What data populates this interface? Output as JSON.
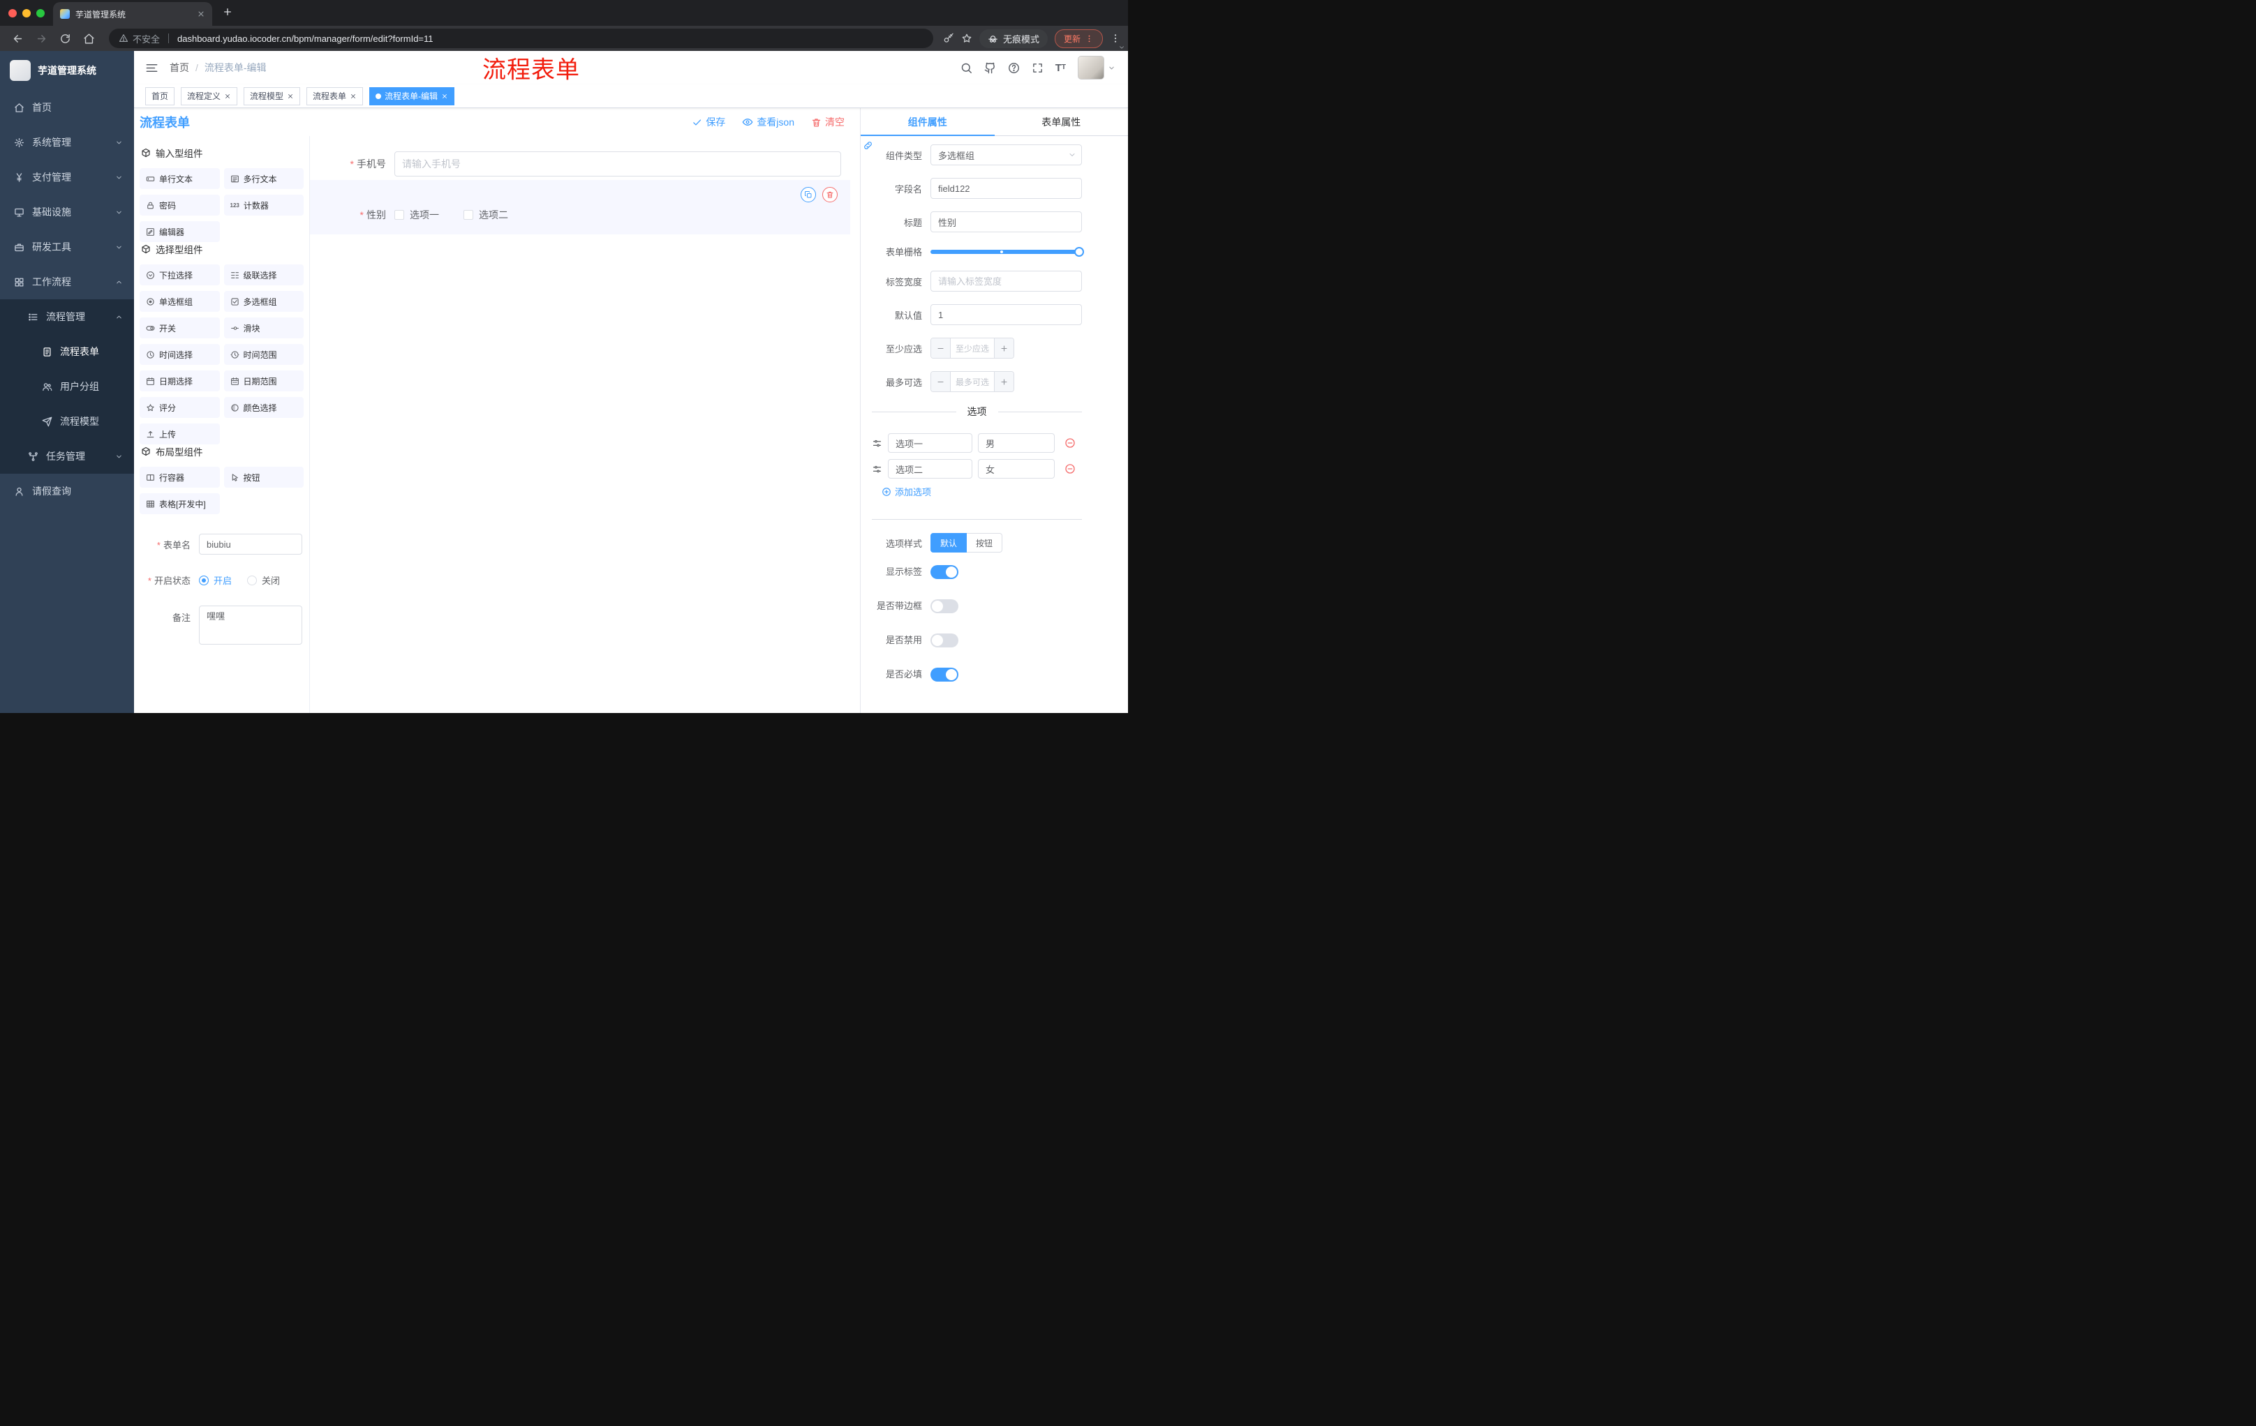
{
  "colors": {
    "accent": "#409eff",
    "danger": "#f56c6c",
    "annotation_red": "#f21d0d",
    "sidebar_bg": "#304156",
    "sidebar_sub_bg": "#1f2d3d",
    "tag_active": "#409eff"
  },
  "browser": {
    "tab": {
      "title": "芋道管理系统"
    },
    "nav_icons": [
      {
        "id": "back",
        "disabled": false
      },
      {
        "id": "forward",
        "disabled": true
      },
      {
        "id": "reload",
        "disabled": false
      },
      {
        "id": "homebtn",
        "disabled": false
      }
    ],
    "address": {
      "security_label": "不安全",
      "url": "dashboard.yudao.iocoder.cn/bpm/manager/form/edit?formId=11"
    },
    "incognito_label": "无痕模式",
    "update_button": "更新"
  },
  "sidebar": {
    "logo_title": "芋道管理系统",
    "items": [
      {
        "id": "home",
        "label": "首页",
        "icon": "home",
        "level": 1
      },
      {
        "id": "system",
        "label": "系统管理",
        "icon": "gear",
        "level": 1,
        "chevron": "down"
      },
      {
        "id": "payment",
        "label": "支付管理",
        "icon": "yen",
        "level": 1,
        "chevron": "down"
      },
      {
        "id": "infra",
        "label": "基础设施",
        "icon": "monitor",
        "level": 1,
        "chevron": "down"
      },
      {
        "id": "devtools",
        "label": "研发工具",
        "icon": "toolbox",
        "level": 1,
        "chevron": "down"
      },
      {
        "id": "workflow",
        "label": "工作流程",
        "icon": "grid",
        "level": 1,
        "chevron": "up"
      },
      {
        "id": "process-mgmt",
        "label": "流程管理",
        "icon": "list",
        "level": 2,
        "chevron": "up"
      },
      {
        "id": "process-form",
        "label": "流程表单",
        "icon": "document",
        "level": 3,
        "active": true
      },
      {
        "id": "user-group",
        "label": "用户分组",
        "icon": "users",
        "level": 3
      },
      {
        "id": "process-model",
        "label": "流程模型",
        "icon": "send",
        "level": 3
      },
      {
        "id": "task-mgmt",
        "label": "任务管理",
        "icon": "tree",
        "level": 2,
        "chevron": "down"
      },
      {
        "id": "leave-query",
        "label": "请假查询",
        "icon": "person",
        "level": 1
      }
    ]
  },
  "header": {
    "breadcrumb": {
      "home": "首页",
      "separator": "/",
      "current": "流程表单-编辑"
    },
    "overlay_title": "流程表单",
    "icons": [
      {
        "id": "search"
      },
      {
        "id": "github"
      },
      {
        "id": "question"
      },
      {
        "id": "expand"
      },
      {
        "id": "fontsize"
      }
    ]
  },
  "tags": [
    {
      "label": "首页",
      "closable": false,
      "active": false
    },
    {
      "label": "流程定义",
      "closable": true,
      "active": false
    },
    {
      "label": "流程模型",
      "closable": true,
      "active": false
    },
    {
      "label": "流程表单",
      "closable": true,
      "active": false
    },
    {
      "label": "流程表单-编辑",
      "closable": true,
      "active": true
    }
  ],
  "editor": {
    "title": "流程表单",
    "actions": {
      "save": "保存",
      "view_json": "查看json",
      "clear": "清空"
    },
    "palette_sections": [
      {
        "title": "输入型组件",
        "items": [
          {
            "label": "单行文本",
            "icon": "input"
          },
          {
            "label": "多行文本",
            "icon": "textarea"
          },
          {
            "label": "密码",
            "icon": "lock"
          },
          {
            "label": "计数器",
            "icon": "counter"
          },
          {
            "label": "编辑器",
            "icon": "editor"
          }
        ]
      },
      {
        "title": "选择型组件",
        "items": [
          {
            "label": "下拉选择",
            "icon": "select"
          },
          {
            "label": "级联选择",
            "icon": "cascader"
          },
          {
            "label": "单选框组",
            "icon": "radio"
          },
          {
            "label": "多选框组",
            "icon": "checkbox"
          },
          {
            "label": "开关",
            "icon": "switch"
          },
          {
            "label": "滑块",
            "icon": "slider"
          },
          {
            "label": "时间选择",
            "icon": "time"
          },
          {
            "label": "时间范围",
            "icon": "time-range"
          },
          {
            "label": "日期选择",
            "icon": "date"
          },
          {
            "label": "日期范围",
            "icon": "date-range"
          },
          {
            "label": "评分",
            "icon": "star"
          },
          {
            "label": "颜色选择",
            "icon": "color"
          },
          {
            "label": "上传",
            "icon": "upload"
          }
        ]
      },
      {
        "title": "布局型组件",
        "items": [
          {
            "label": "行容器",
            "icon": "row"
          },
          {
            "label": "按钮",
            "icon": "pointer"
          },
          {
            "label": "表格[开发中]",
            "icon": "table"
          }
        ]
      }
    ],
    "meta_form": {
      "name_label": "表单名",
      "name_value": "biubiu",
      "status_label": "开启状态",
      "status_on": "开启",
      "status_off": "关闭",
      "remark_label": "备注",
      "remark_value": "嘿嘿"
    },
    "canvas": {
      "phone_label": "手机号",
      "phone_placeholder": "请输入手机号",
      "gender_label": "性别",
      "gender_options": [
        "选项一",
        "选项二"
      ]
    }
  },
  "props": {
    "tabs": {
      "component": "组件属性",
      "form": "表单属性"
    },
    "component_type_label": "组件类型",
    "component_type_value": "多选框组",
    "field_name_label": "字段名",
    "field_name_value": "field122",
    "title_label": "标题",
    "title_value": "性别",
    "grid_label": "表单栅格",
    "label_width_label": "标签宽度",
    "label_width_placeholder": "请输入标签宽度",
    "default_label": "默认值",
    "default_value": "1",
    "min_label": "至少应选",
    "min_placeholder": "至少应选",
    "max_label": "最多可选",
    "max_placeholder": "最多可选",
    "options_title": "选项",
    "options": [
      {
        "label": "选项一",
        "value": "男"
      },
      {
        "label": "选项二",
        "value": "女"
      }
    ],
    "add_option_label": "添加选项",
    "option_style_label": "选项样式",
    "option_style_choices": [
      {
        "label": "默认",
        "active": true
      },
      {
        "label": "按钮",
        "active": false
      }
    ],
    "switches": [
      {
        "label": "显示标签",
        "on": true
      },
      {
        "label": "是否带边框",
        "on": false
      },
      {
        "label": "是否禁用",
        "on": false
      },
      {
        "label": "是否必填",
        "on": true
      }
    ]
  }
}
